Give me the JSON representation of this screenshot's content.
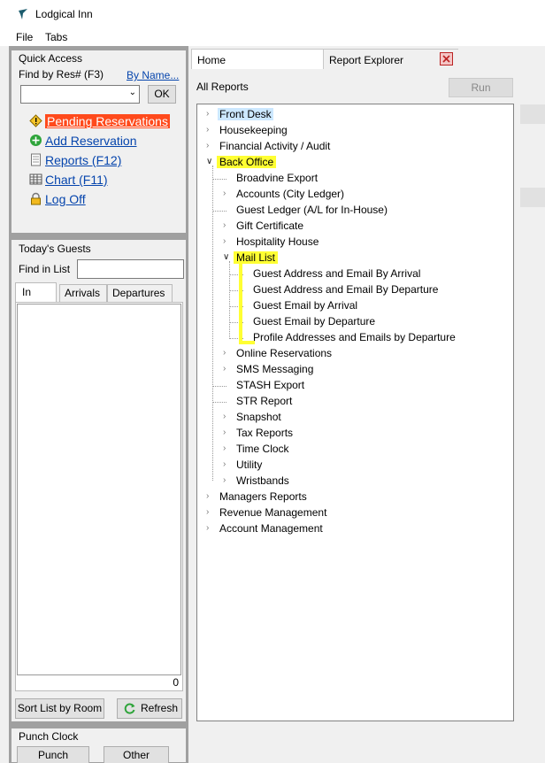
{
  "window": {
    "title": "Lodgical Inn"
  },
  "menu": [
    "File",
    "Tabs"
  ],
  "quick_access": {
    "title": "Quick Access",
    "find_label": "Find by Res# (F3)",
    "by_name_link": "By Name...",
    "ok_label": "OK",
    "links": [
      {
        "label": "Pending Reservations",
        "icon": "warning-icon"
      },
      {
        "label": "Add Reservation",
        "icon": "add-icon"
      },
      {
        "label": "Reports (F12)",
        "icon": "document-icon"
      },
      {
        "label": "Chart (F11)",
        "icon": "chart-icon"
      },
      {
        "label": "Log Off",
        "icon": "lock-icon"
      }
    ]
  },
  "todays_guests": {
    "title": "Today's Guests",
    "find_label": "Find in List",
    "tabs": [
      "In",
      "Arrivals",
      "Departures"
    ],
    "count": "0",
    "sort_label": "Sort List by Room",
    "refresh_label": "Refresh"
  },
  "punch_clock": {
    "title": "Punch Clock",
    "punch_label": "Punch",
    "other_label": "Other"
  },
  "tabs": [
    {
      "label": "Home"
    },
    {
      "label": "Report Explorer"
    }
  ],
  "report_explorer": {
    "heading": "All Reports",
    "run_label": "Run",
    "tree": [
      {
        "label": "Front Desk",
        "level": 0,
        "expander": "closed",
        "highlight": "blue"
      },
      {
        "label": "Housekeeping",
        "level": 0,
        "expander": "closed"
      },
      {
        "label": "Financial Activity / Audit",
        "level": 0,
        "expander": "closed"
      },
      {
        "label": "Back Office",
        "level": 0,
        "expander": "open",
        "highlight": "yellow"
      },
      {
        "label": "Broadvine Export",
        "level": 1,
        "expander": "none"
      },
      {
        "label": "Accounts (City Ledger)",
        "level": 1,
        "expander": "closed"
      },
      {
        "label": "Guest Ledger (A/L for In-House)",
        "level": 1,
        "expander": "none"
      },
      {
        "label": "Gift Certificate",
        "level": 1,
        "expander": "closed"
      },
      {
        "label": "Hospitality House",
        "level": 1,
        "expander": "closed"
      },
      {
        "label": "Mail List",
        "level": 1,
        "expander": "open",
        "highlight": "yellow"
      },
      {
        "label": "Guest Address and Email By Arrival",
        "level": 2,
        "expander": "none"
      },
      {
        "label": "Guest Address and Email By Departure",
        "level": 2,
        "expander": "none"
      },
      {
        "label": "Guest Email by Arrival",
        "level": 2,
        "expander": "none"
      },
      {
        "label": "Guest Email by Departure",
        "level": 2,
        "expander": "none"
      },
      {
        "label": "Profile Addresses and Emails by Departure",
        "level": 2,
        "expander": "none"
      },
      {
        "label": "Online Reservations",
        "level": 1,
        "expander": "closed"
      },
      {
        "label": "SMS Messaging",
        "level": 1,
        "expander": "closed"
      },
      {
        "label": "STASH Export",
        "level": 1,
        "expander": "none"
      },
      {
        "label": "STR Report",
        "level": 1,
        "expander": "none"
      },
      {
        "label": "Snapshot",
        "level": 1,
        "expander": "closed"
      },
      {
        "label": "Tax Reports",
        "level": 1,
        "expander": "closed"
      },
      {
        "label": "Time Clock",
        "level": 1,
        "expander": "closed"
      },
      {
        "label": "Utility",
        "level": 1,
        "expander": "closed"
      },
      {
        "label": "Wristbands",
        "level": 1,
        "expander": "closed"
      },
      {
        "label": "Managers Reports",
        "level": 0,
        "expander": "closed"
      },
      {
        "label": "Revenue Management",
        "level": 0,
        "expander": "closed"
      },
      {
        "label": "Account Management",
        "level": 0,
        "expander": "closed"
      }
    ]
  },
  "colors": {
    "link": "#0645ad",
    "selected": "#cce8ff",
    "highlighter": "#ffff33",
    "pending_bg": "#ff4a1c"
  }
}
